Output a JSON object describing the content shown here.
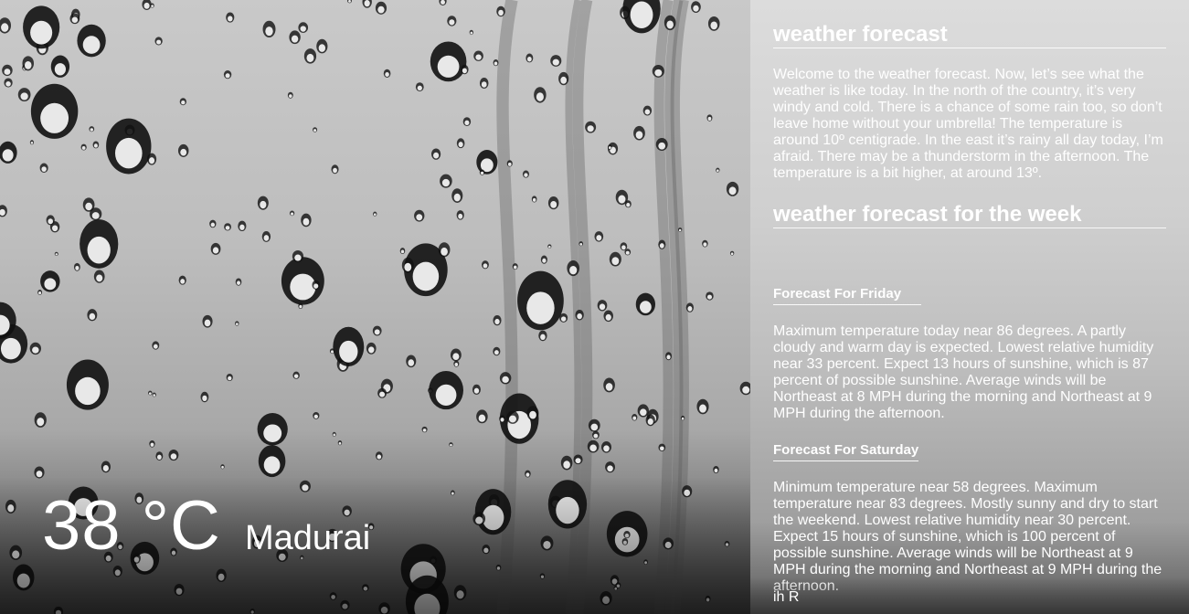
{
  "current": {
    "temperature": "38 °C",
    "city": "Madurai"
  },
  "forecast": {
    "title": "weather forecast",
    "intro": "Welcome to the weather forecast. Now, let’s see what the weather is like today. In the north of the country, it’s very windy and cold. There is a chance of some rain too, so don’t leave home without your umbrella! The temperature is around 10º centigrade. In the east it’s rainy all day today, I’m afraid. There may be a thunderstorm in the afternoon. The temperature is a bit higher, at around 13º."
  },
  "week": {
    "title": "weather forecast for the week",
    "days": [
      {
        "title": "Forecast For Friday",
        "text": "Maximum temperature today near 86 degrees. A partly cloudy and warm day is expected. Lowest relative humidity near 33 percent. Expect 13 hours of sunshine, which is 87 percent of possible sunshine. Average winds will be Northeast at 8 MPH during the morning and Northeast at 9 MPH during the afternoon."
      },
      {
        "title": "Forecast For Saturday",
        "text": "Minimum temperature near 58 degrees. Maximum temperature near 83 degrees. Mostly sunny and dry to start the weekend. Lowest relative humidity near 30 percent. Expect 15 hours of sunshine, which is 100 percent of possible sunshine. Average winds will be Northeast at 9 MPH during the morning and Northeast at 9 MPH during the afternoon."
      }
    ],
    "cut_off_text": "ih R"
  },
  "colors": {
    "text": "#ffffff",
    "scene_base": "#bdbdbd",
    "panel_base": "#cfcfcf"
  },
  "icons": {
    "background": "rain-drops-image"
  }
}
